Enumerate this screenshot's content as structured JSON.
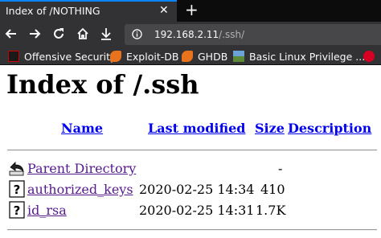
{
  "browser": {
    "tab_title": "Index of /NOTHING",
    "tab_close": "✕",
    "new_tab": "+",
    "url_host": "192.168.2.11",
    "url_path": "/.ssh/",
    "bookmarks": [
      "Offensive Security",
      "Exploit-DB",
      "GHDB",
      "Basic Linux Privilege ..."
    ],
    "accent_color": "#0a84ff"
  },
  "page": {
    "title": "Index of /.ssh",
    "columns": [
      "Name",
      "Last modified",
      "Size",
      "Description"
    ],
    "parent": {
      "name": "Parent Directory",
      "modified": "",
      "size": "-"
    },
    "rows": [
      {
        "name": "authorized_keys",
        "modified": "2020-02-25 14:34",
        "size": "410"
      },
      {
        "name": "id_rsa",
        "modified": "2020-02-25 14:31",
        "size": "1.7K"
      }
    ]
  }
}
